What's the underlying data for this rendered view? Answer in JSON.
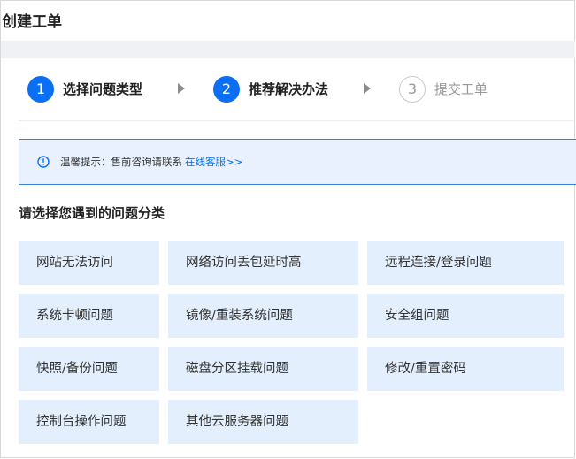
{
  "page": {
    "title": "创建工单"
  },
  "steps": [
    {
      "number": "1",
      "label": "选择问题类型",
      "state": "active"
    },
    {
      "number": "2",
      "label": "推荐解决办法",
      "state": "active"
    },
    {
      "number": "3",
      "label": "提交工单",
      "state": "inactive"
    }
  ],
  "notice": {
    "icon": "info-icon",
    "text": "温馨提示：售前咨询请联系",
    "link": "在线客服>>"
  },
  "categories_title": "请选择您遇到的问题分类",
  "categories": [
    "网站无法访问",
    "网络访问丢包延时高",
    "远程连接/登录问题",
    "系统卡顿问题",
    "镜像/重装系统问题",
    "安全组问题",
    "快照/备份问题",
    "磁盘分区挂载问题",
    "修改/重置密码",
    "控制台操作问题",
    "其他云服务器问题"
  ],
  "colors": {
    "accent": "#0a6ff5",
    "tile_bg": "#e4effd",
    "notice_bg": "#e8f1fd",
    "notice_border": "#3f7fd9"
  }
}
